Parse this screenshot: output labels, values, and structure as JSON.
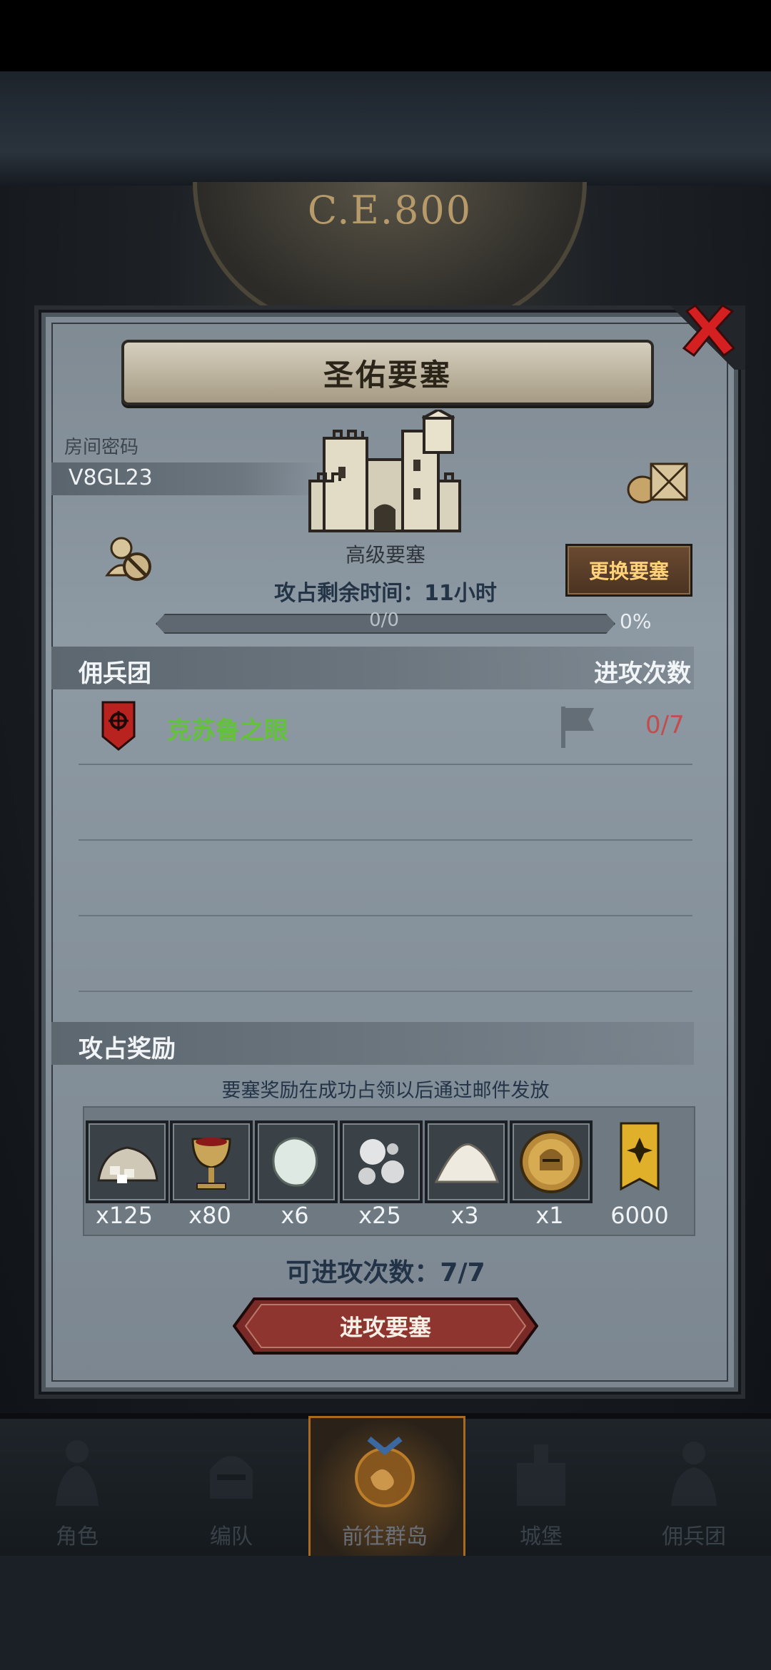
{
  "background": {
    "era_label": "C.E.800"
  },
  "modal": {
    "title": "圣佑要塞",
    "room": {
      "label": "房间密码",
      "code": "V8GL23"
    },
    "fortress": {
      "grade": "高级要塞",
      "switch_label": "更换要塞"
    },
    "remaining_time": "攻占剩余时间：11小时",
    "progress": {
      "text": "0/0",
      "percent_text": "0%",
      "fraction": 0
    },
    "mercenary_section": {
      "left_header": "佣兵团",
      "right_header": "进攻次数",
      "rows": [
        {
          "name": "克苏鲁之眼",
          "count": "0/7"
        }
      ]
    },
    "rewards": {
      "header": "攻占奖励",
      "note": "要塞奖励在成功占领以后通过邮件发放",
      "items": [
        {
          "icon": "stone-pile-icon",
          "qty": "x125"
        },
        {
          "icon": "goblet-icon",
          "qty": "x80"
        },
        {
          "icon": "gem-icon",
          "qty": "x6"
        },
        {
          "icon": "pearls-icon",
          "qty": "x25"
        },
        {
          "icon": "salt-pile-icon",
          "qty": "x3"
        },
        {
          "icon": "helmet-coin-icon",
          "qty": "x1"
        },
        {
          "icon": "banner-icon",
          "qty": "6000"
        }
      ]
    },
    "attack_count": "可进攻次数：7/7",
    "attack_button": "进攻要塞"
  },
  "bottom_nav": [
    {
      "label": "角色",
      "icon": "knight-icon"
    },
    {
      "label": "编队",
      "icon": "helmet-icon"
    },
    {
      "label": "前往群岛",
      "icon": "islands-icon",
      "active": true
    },
    {
      "label": "城堡",
      "icon": "castle-icon"
    },
    {
      "label": "佣兵团",
      "icon": "mercenary-icon"
    }
  ],
  "colors": {
    "mercenary_name": "#63c13c",
    "attack_count_red": "#c24d4d",
    "switch_text": "#ffd27a",
    "close_red": "#d42020"
  }
}
